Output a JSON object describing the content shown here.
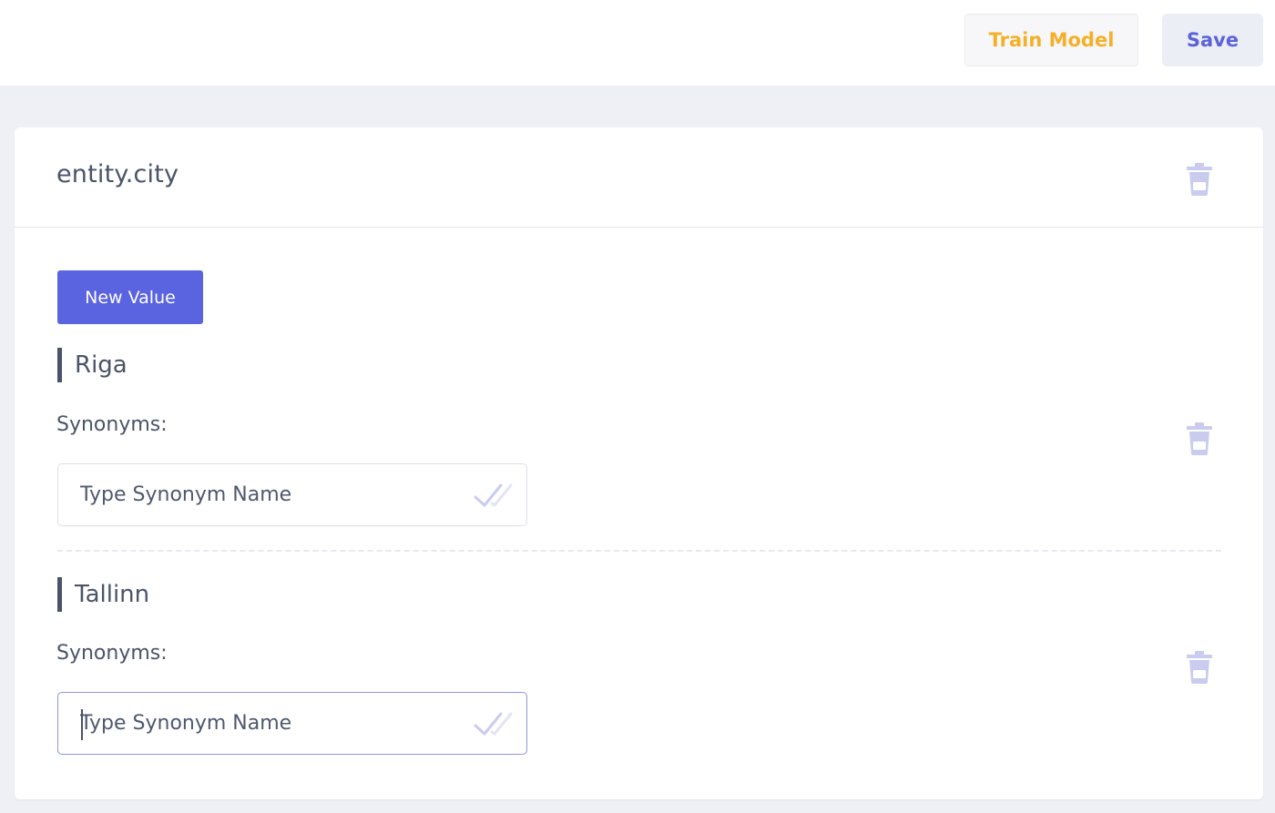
{
  "toolbar": {
    "train_label": "Train Model",
    "save_label": "Save"
  },
  "entity": {
    "title": "entity.city",
    "new_value_label": "New Value",
    "values": [
      {
        "name": "Riga",
        "synonyms_label": "Synonyms:",
        "input_value": "",
        "input_placeholder": "Type Synonym Name",
        "focused": false
      },
      {
        "name": "Tallinn",
        "synonyms_label": "Synonyms:",
        "input_value": "",
        "input_placeholder": "Type Synonym Name",
        "focused": true
      }
    ]
  },
  "icons": {
    "delete": "trash-icon",
    "confirm": "double-check-icon"
  },
  "colors": {
    "accent": "#5a63e0",
    "train_text": "#f5b02a",
    "save_text": "#5b63d8",
    "text": "#4a5468",
    "icon_muted": "#c9ccef",
    "page_bg": "#eef0f6"
  }
}
